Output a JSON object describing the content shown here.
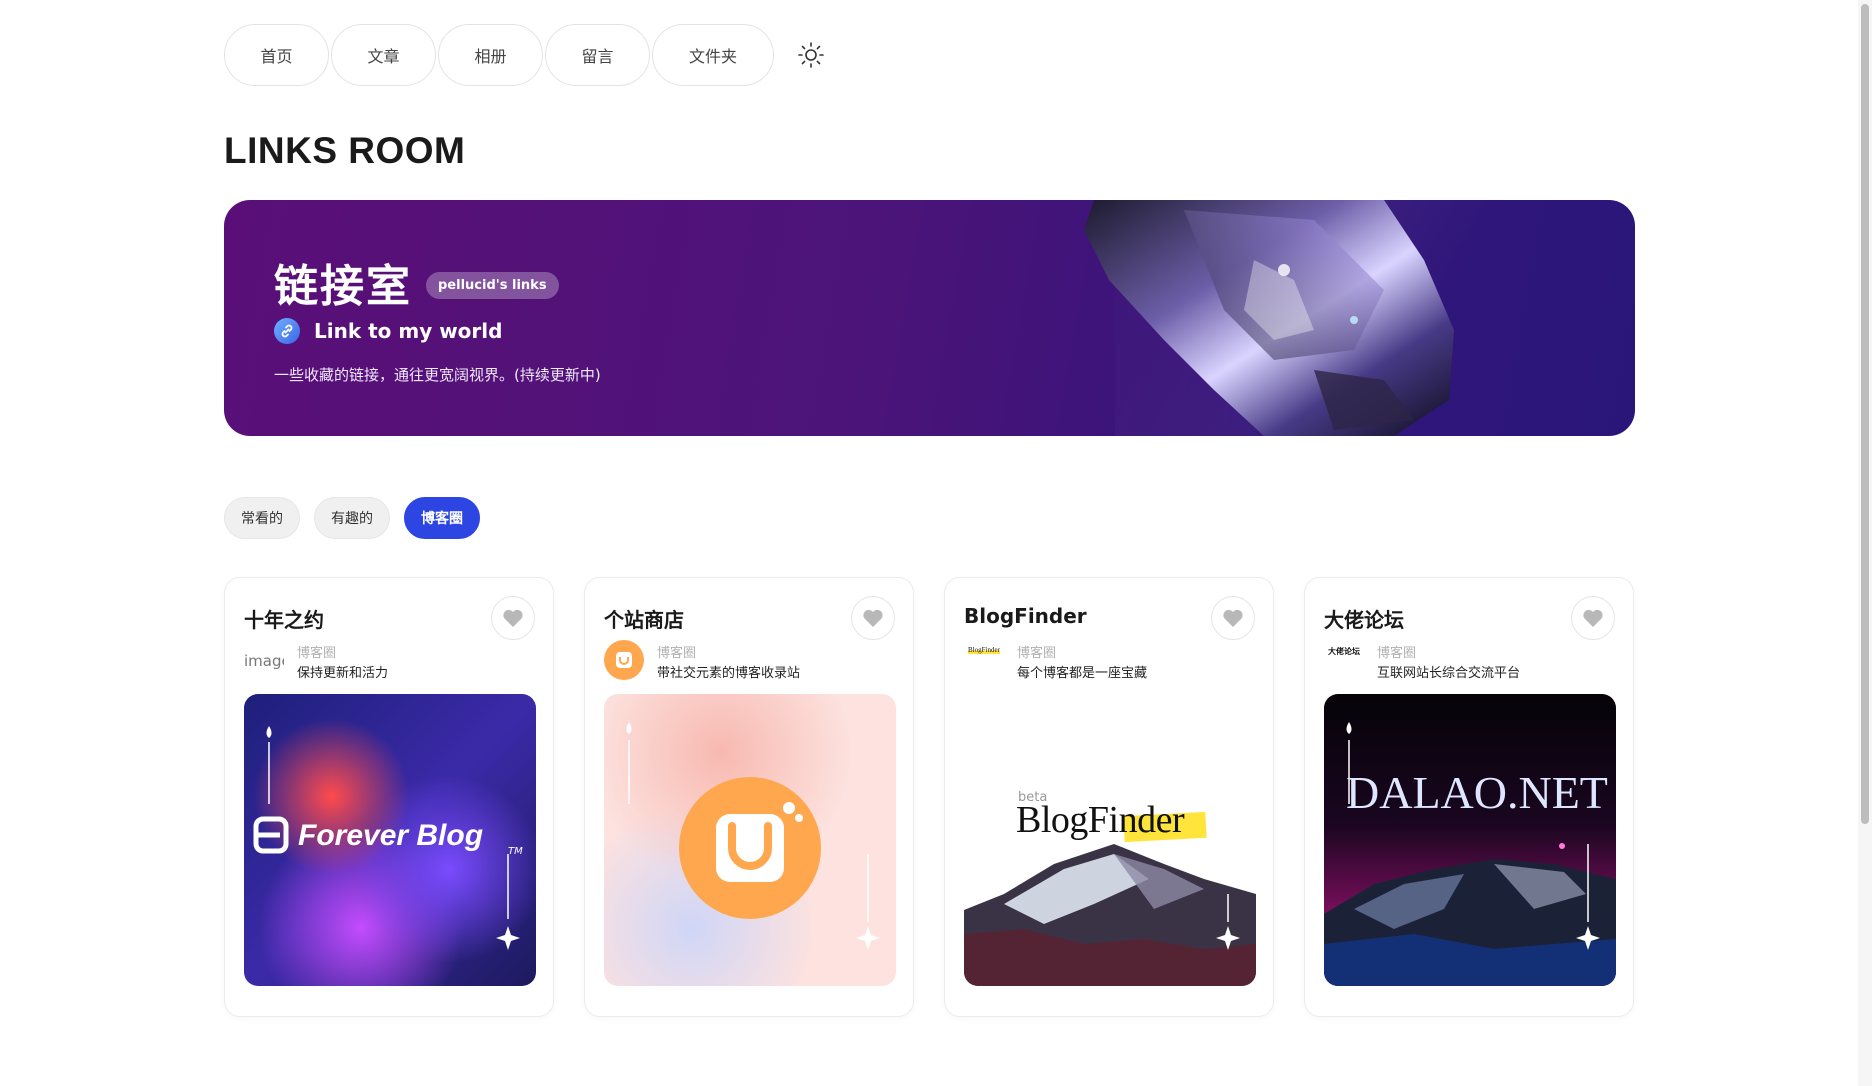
{
  "nav": {
    "items": [
      {
        "label": "首页"
      },
      {
        "label": "文章"
      },
      {
        "label": "相册"
      },
      {
        "label": "留言"
      },
      {
        "label": "文件夹"
      }
    ],
    "theme_icon": "sun-icon"
  },
  "page_title": "LINKS ROOM",
  "banner": {
    "title": "链接室",
    "badge": "pellucid's links",
    "subtitle": "Link to my world",
    "description": "一些收藏的链接，通往更宽阔视界。(持续更新中)",
    "link_icon": "link-icon"
  },
  "filters": [
    {
      "label": "常看的",
      "active": false
    },
    {
      "label": "有趣的",
      "active": false
    },
    {
      "label": "博客圈",
      "active": true
    }
  ],
  "cards": [
    {
      "name": "十年之约",
      "avatar_alt": "image",
      "tag": "博客圈",
      "desc": "保持更新和活力",
      "cover_text": "Forever Blog",
      "cover_tm": "TM"
    },
    {
      "name": "个站商店",
      "tag": "博客圈",
      "desc": "带社交元素的博客收录站"
    },
    {
      "name": "BlogFinder",
      "avatar_text": "BlogFinder",
      "tag": "博客圈",
      "desc": "每个博客都是一座宝藏",
      "cover_beta": "beta",
      "cover_text": "BlogFinder"
    },
    {
      "name": "大佬论坛",
      "avatar_text": "大佬论坛",
      "tag": "博客圈",
      "desc": "互联网站长综合交流平台",
      "cover_text": "DALAO.NET"
    }
  ],
  "colors": {
    "accent": "#2d46e3",
    "banner_start": "#5a0f78",
    "banner_end": "#2a1679"
  }
}
